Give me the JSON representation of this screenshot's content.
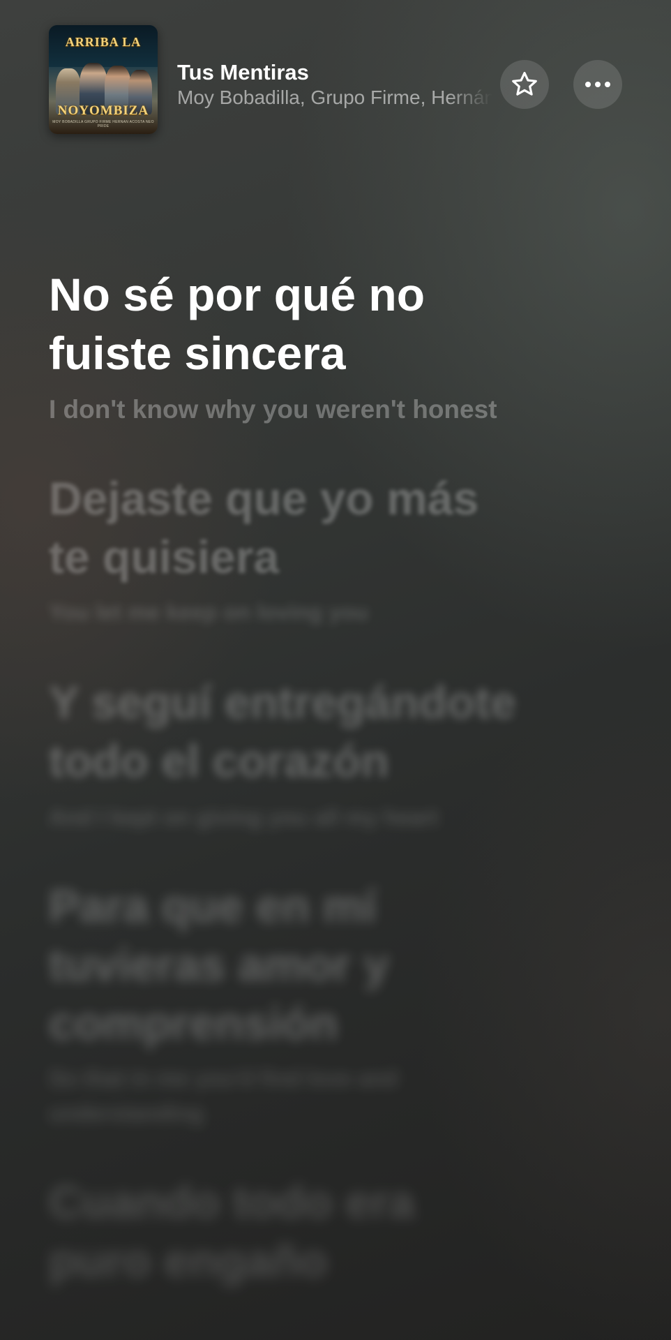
{
  "now_playing": {
    "title": "Tus Mentiras",
    "artists": "Moy Bobadilla, Grupo Firme, Hernán Acosta",
    "artwork": {
      "line1": "ARRIBA LA",
      "line2": "NOYOMBIZA",
      "credits": "MOY BOBADILLA  GRUPO FIRME  HERNAN ACOSTA  NEO PRIDE"
    }
  },
  "actions": {
    "favorite_icon": "star-icon",
    "more_icon": "more-icon"
  },
  "lyrics": [
    {
      "original": "No sé por qué no fuiste sincera",
      "translation": "I don't know why you weren't honest",
      "state": "active"
    },
    {
      "original": "Dejaste que yo más te quisiera",
      "translation": "You let me keep on loving you",
      "state": "upcoming"
    },
    {
      "original": "Y seguí entregándote todo el corazón",
      "translation": "And I kept on giving you all my heart",
      "state": "upcoming"
    },
    {
      "original": "Para que en mí tuvieras amor y comprensión",
      "translation": "So that in me you'd find love and understanding",
      "state": "upcoming"
    },
    {
      "original": "Cuando todo era puro engaño",
      "translation": "",
      "state": "upcoming"
    }
  ],
  "colors": {
    "background_top": "#3e403e",
    "background_bottom": "#222221",
    "text_primary": "#ffffff"
  }
}
